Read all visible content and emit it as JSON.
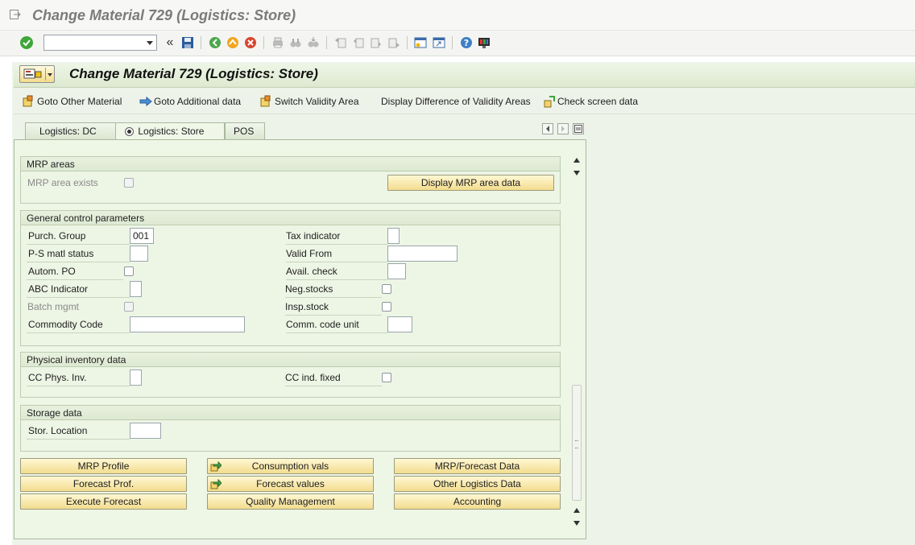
{
  "window": {
    "title": "Change Material 729 (Logistics: Store)"
  },
  "toolbar": {
    "command_value": "",
    "icons": [
      "enter-check-icon",
      "command-field",
      "collapse-icon",
      "save-icon",
      "back-icon",
      "exit-icon",
      "cancel-icon",
      "print-icon",
      "find-icon",
      "find-next-icon",
      "first-page-icon",
      "previous-page-icon",
      "next-page-icon",
      "last-page-icon",
      "create-session-icon",
      "shortcut-icon",
      "help-icon",
      "customize-layout-icon"
    ],
    "collapse_glyph": "«"
  },
  "header": {
    "title": "Change Material 729 (Logistics: Store)"
  },
  "app_toolbar": {
    "goto_other_material": "Goto Other Material",
    "goto_additional_data": "Goto Additional data",
    "switch_validity_area": "Switch Validity Area",
    "display_difference": "Display Difference of Validity Areas",
    "check_screen_data": "Check screen data"
  },
  "tabs": [
    {
      "label": "Logistics: DC",
      "active": false
    },
    {
      "label": "Logistics: Store",
      "active": true
    },
    {
      "label": "POS",
      "active": false
    }
  ],
  "groups": {
    "mrp_areas": {
      "title": "MRP areas",
      "mrp_area_exists_label": "MRP area exists",
      "mrp_area_exists_checked": false,
      "display_button": "Display MRP area data"
    },
    "general": {
      "title": "General control parameters",
      "purch_group_label": "Purch. Group",
      "purch_group_value": "001",
      "ps_matl_status_label": "P-S matl status",
      "ps_matl_status_value": "",
      "autom_po_label": "Autom. PO",
      "abc_indicator_label": "ABC Indicator",
      "abc_indicator_value": "",
      "batch_mgmt_label": "Batch mgmt",
      "commodity_code_label": "Commodity Code",
      "commodity_code_value": "",
      "tax_indicator_label": "Tax indicator",
      "tax_indicator_value": "",
      "valid_from_label": "Valid From",
      "valid_from_value": "",
      "avail_check_label": "Avail. check",
      "avail_check_value": "",
      "neg_stocks_label": "Neg.stocks",
      "insp_stock_label": "Insp.stock",
      "comm_code_unit_label": "Comm. code unit",
      "comm_code_unit_value": ""
    },
    "physical": {
      "title": "Physical inventory data",
      "cc_phys_inv_label": "CC Phys. Inv.",
      "cc_phys_inv_value": "",
      "cc_ind_fixed_label": "CC ind. fixed"
    },
    "storage": {
      "title": "Storage data",
      "stor_location_label": "Stor. Location",
      "stor_location_value": ""
    }
  },
  "buttons": {
    "mrp_profile": "MRP Profile",
    "forecast_prof": "Forecast Prof.",
    "execute_forecast": "Execute Forecast",
    "consumption_vals": "Consumption vals",
    "forecast_values": "Forecast values",
    "quality_management": "Quality Management",
    "mrp_forecast_data": "MRP/Forecast Data",
    "other_logistics_data": "Other Logistics Data",
    "accounting": "Accounting"
  },
  "colors": {
    "accent_button": "#f2dc8e",
    "panel_bg": "#eef6e6",
    "highlight_underline": "#e02020"
  }
}
